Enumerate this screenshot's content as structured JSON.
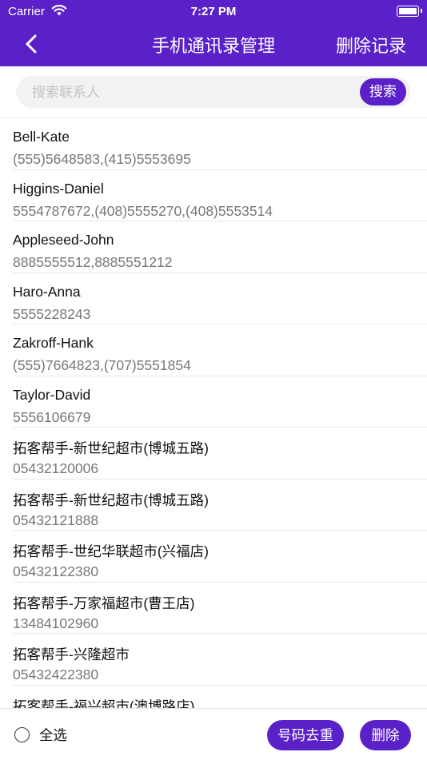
{
  "status_bar": {
    "carrier": "Carrier",
    "time": "7:27 PM"
  },
  "header": {
    "title": "手机通讯录管理",
    "delete_records_label": "删除记录"
  },
  "search": {
    "placeholder": "搜索联系人",
    "button_label": "搜索"
  },
  "contacts": [
    {
      "name": "Bell-Kate",
      "phones": "(555)5648583,(415)5553695"
    },
    {
      "name": "Higgins-Daniel",
      "phones": "5554787672,(408)5555270,(408)5553514"
    },
    {
      "name": "Appleseed-John",
      "phones": "8885555512,8885551212"
    },
    {
      "name": "Haro-Anna",
      "phones": "5555228243"
    },
    {
      "name": "Zakroff-Hank",
      "phones": "(555)7664823,(707)5551854"
    },
    {
      "name": "Taylor-David",
      "phones": "5556106679"
    },
    {
      "name": "拓客帮手-新世纪超市(博城五路)",
      "phones": "05432120006"
    },
    {
      "name": "拓客帮手-新世纪超市(博城五路)",
      "phones": "05432121888"
    },
    {
      "name": "拓客帮手-世纪华联超市(兴福店)",
      "phones": "05432122380"
    },
    {
      "name": "拓客帮手-万家福超市(曹王店)",
      "phones": "13484102960"
    },
    {
      "name": "拓客帮手-兴隆超市",
      "phones": "05432422380"
    },
    {
      "name": "拓客帮手-福兴超市(澳博路店)",
      "phones": ""
    }
  ],
  "bottom_bar": {
    "select_all_label": "全选",
    "dedupe_label": "号码去重",
    "delete_label": "删除"
  },
  "colors": {
    "accent": "#5b21c8"
  }
}
